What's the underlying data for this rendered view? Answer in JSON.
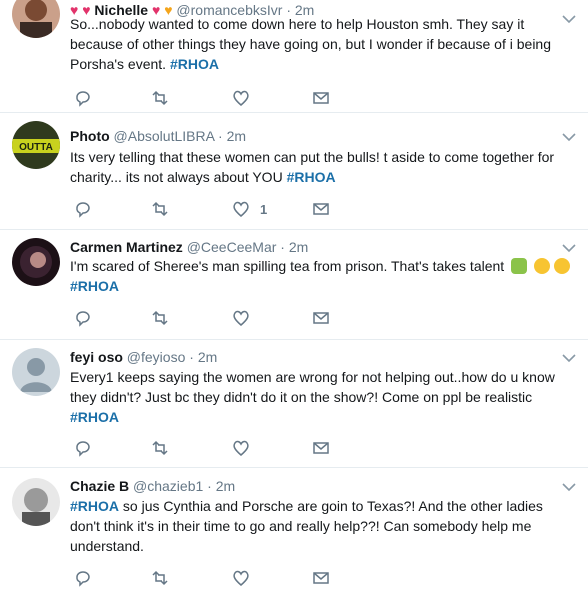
{
  "tweets": [
    {
      "name": "Nichelle",
      "handle": "@romancebksIvr",
      "time": "2m",
      "text": "So...nobody wanted to come down here to help Houston smh. They say it because of other things they have going on, but I wonder if because of i being Porsha's event.",
      "hashtag": "#RHOA",
      "likes": ""
    },
    {
      "name": "Photo",
      "handle": "@AbsolutLIBRA",
      "time": "2m",
      "text": "Its very telling that these women can put the bulls!  t aside to come together for charity... its not always about YOU",
      "hashtag": "#RHOA",
      "likes": "1",
      "avatar_text": "OUTTA"
    },
    {
      "name": "Carmen Martinez",
      "handle": "@CeeCeeMar",
      "time": "2m",
      "text": "I'm scared of Sheree's man spilling tea from prison. That's takes talent",
      "hashtag": "#RHOA",
      "likes": ""
    },
    {
      "name": "feyi oso",
      "handle": "@feyioso",
      "time": "2m",
      "text": "Every1 keeps saying the women are wrong for not helping out..how do u know they didn't? Just bc they didn't do it on the show?! Come on ppl be realistic",
      "hashtag": "#RHOA",
      "likes": ""
    },
    {
      "name": "Chazie B",
      "handle": "@chazieb1",
      "time": "2m",
      "text": "so jus Cynthia and Porsche are goin to Texas?! And the other ladies don't think it's in their time to go and really help??! Can somebody help me understand.",
      "hashtag": "#RHOA",
      "likes": ""
    }
  ],
  "colors": {
    "hashtag": "#1b6fa8",
    "meta": "#657786",
    "text": "#14171a",
    "divider": "#e6ecf0"
  },
  "icons": [
    "reply-icon",
    "retweet-icon",
    "like-icon",
    "direct-message-icon",
    "caret-down-icon"
  ]
}
